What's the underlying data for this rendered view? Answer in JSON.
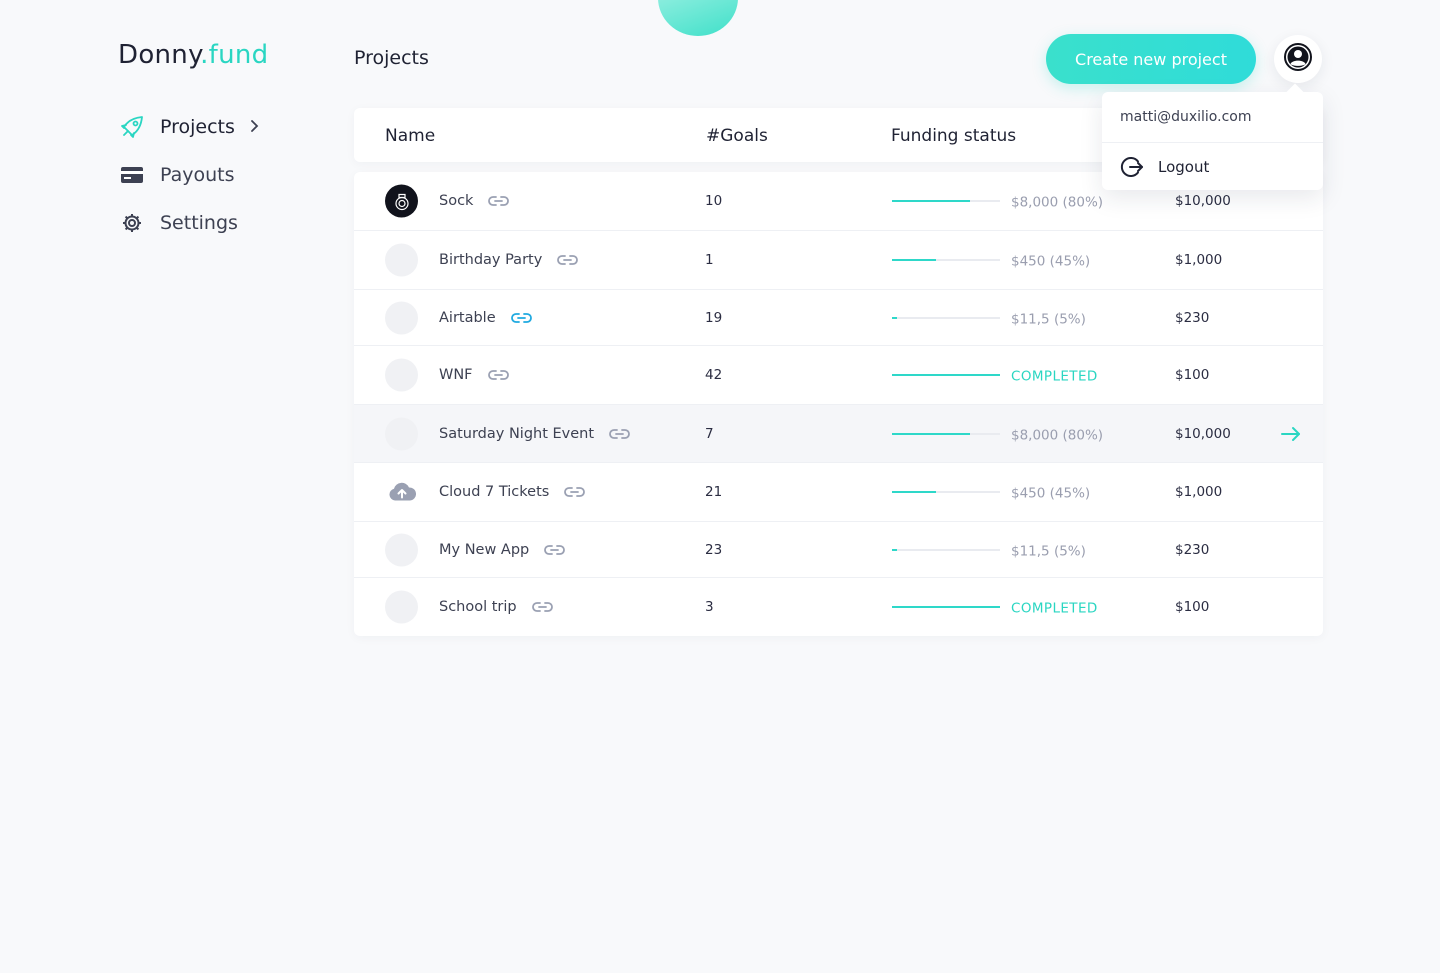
{
  "brand": {
    "name_part1": "Donny",
    "name_part2": ".fund",
    "accent": "#2ad6c2"
  },
  "sidebar": {
    "items": [
      {
        "label": "Projects",
        "icon": "rocket-icon",
        "active": true
      },
      {
        "label": "Payouts",
        "icon": "card-icon",
        "active": false
      },
      {
        "label": "Settings",
        "icon": "gear-icon",
        "active": false
      }
    ]
  },
  "header": {
    "title": "Projects",
    "create_button": "Create new project",
    "avatar_icon": "user-avatar-icon"
  },
  "user_menu": {
    "email": "matti@duxilio.com",
    "logout_label": "Logout",
    "logout_icon": "logout-icon"
  },
  "table": {
    "columns": [
      "Name",
      "#Goals",
      "Funding status"
    ],
    "rows": [
      {
        "name": "Sock",
        "goals": "10",
        "funding": "$8,000 (80%)",
        "progress": 0.8,
        "goal": "$10,000",
        "avatar": "dark-logo"
      },
      {
        "name": "Birthday Party",
        "goals": "1",
        "funding": "$450 (45%)",
        "progress": 0.45,
        "goal": "$1,000",
        "avatar": "placeholder"
      },
      {
        "name": "Airtable",
        "goals": "19",
        "funding": "$11,5 (5%)",
        "progress": 0.05,
        "goal": "$230",
        "avatar": "placeholder",
        "link_active": true
      },
      {
        "name": "WNF",
        "goals": "42",
        "funding": "COMPLETED",
        "progress": 1.0,
        "goal": "$100",
        "avatar": "placeholder"
      },
      {
        "name": "Saturday Night Event",
        "goals": "7",
        "funding": "$8,000 (80%)",
        "progress": 0.8,
        "goal": "$10,000",
        "avatar": "placeholder",
        "highlighted": true
      },
      {
        "name": "Cloud 7 Tickets",
        "goals": "21",
        "funding": "$450 (45%)",
        "progress": 0.45,
        "goal": "$1,000",
        "avatar": "cloud-upload-icon"
      },
      {
        "name": "My New App",
        "goals": "23",
        "funding": "$11,5 (5%)",
        "progress": 0.05,
        "goal": "$230",
        "avatar": "placeholder"
      },
      {
        "name": "School trip",
        "goals": "3",
        "funding": "COMPLETED",
        "progress": 1.0,
        "goal": "$100",
        "avatar": "placeholder"
      }
    ]
  },
  "colors": {
    "accent": "#2ad6c2",
    "link_active": "#1fa9e0",
    "link_idle": "#9aa0b2"
  }
}
